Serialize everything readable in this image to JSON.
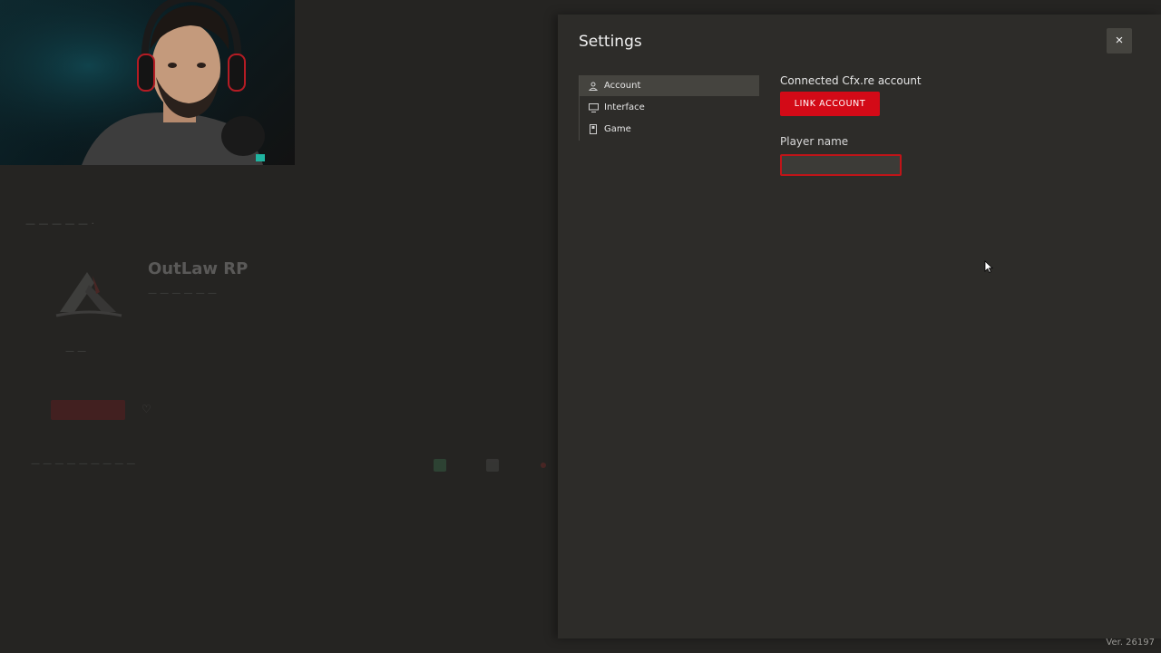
{
  "background_page": {
    "server_title": "OutLaw RP"
  },
  "settings": {
    "title": "Settings",
    "close_label": "×",
    "nav": [
      {
        "label": "Account",
        "icon": "user-icon",
        "active": true
      },
      {
        "label": "Interface",
        "icon": "monitor-icon",
        "active": false
      },
      {
        "label": "Game",
        "icon": "game-icon",
        "active": false
      }
    ],
    "account": {
      "connected_label": "Connected Cfx.re account",
      "link_button": "LINK ACCOUNT",
      "player_name_label": "Player name",
      "player_name_value": "",
      "player_name_placeholder": ""
    }
  },
  "footer": {
    "version": "Ver. 26197"
  },
  "colors": {
    "accent": "#d30a17",
    "panel_bg": "#2d2c29",
    "page_bg": "#252422"
  }
}
